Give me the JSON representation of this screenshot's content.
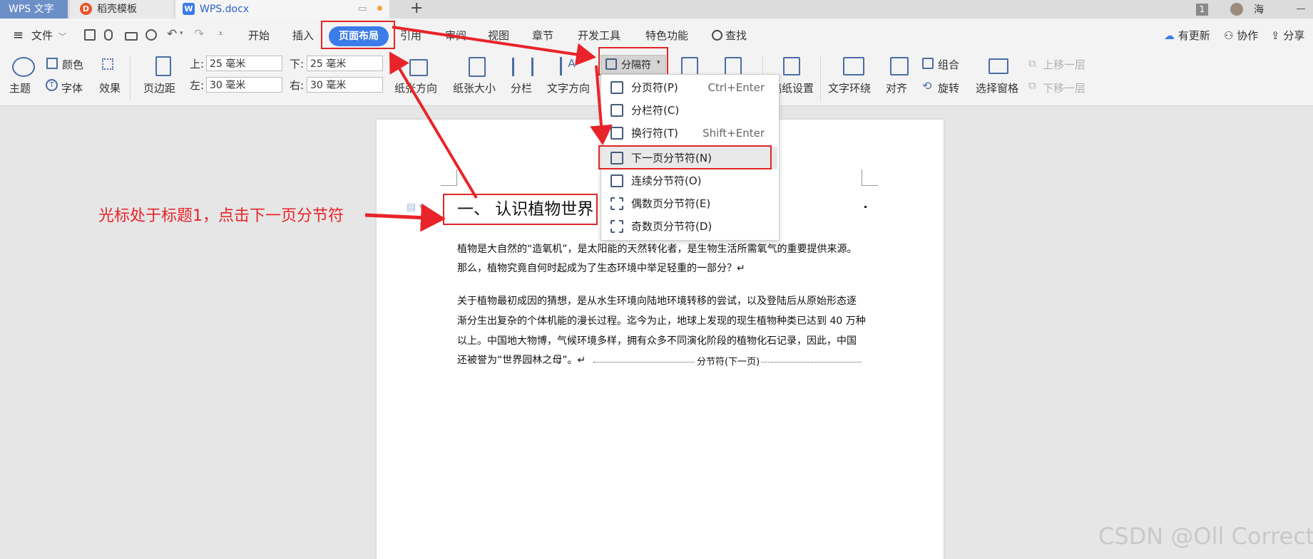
{
  "tabs": {
    "wps": "WPS 文字",
    "daoke": "稻壳模板",
    "doc": "WPS.docx",
    "add": "+",
    "badge": "1",
    "user": "海"
  },
  "menu": {
    "hamburger": "≡",
    "file": "文件",
    "items": [
      "开始",
      "插入",
      "页面布局",
      "引用",
      "审阅",
      "视图",
      "章节",
      "开发工具",
      "特色功能",
      "查找"
    ],
    "update": "有更新",
    "collab": "协作",
    "share": "分享"
  },
  "ribbon": {
    "theme": "主题",
    "color": "颜色",
    "font": "字体",
    "effect": "效果",
    "margin": "页边距",
    "top_label": "上:",
    "top_value": "25 毫米",
    "bottom_label": "下:",
    "bottom_value": "25 毫米",
    "left_label": "左:",
    "left_value": "30 毫米",
    "right_label": "右:",
    "right_value": "30 毫米",
    "orientation": "纸张方向",
    "size": "纸张大小",
    "columns": "分栏",
    "text_dir": "文字方向",
    "breaks": "分隔符",
    "paper_settings": "稿纸设置",
    "wrap": "文字环绕",
    "align": "对齐",
    "group": "组合",
    "rotate": "旋转",
    "select_pane": "选择窗格",
    "bring_forward": "上移一层",
    "send_backward": "下移一层"
  },
  "dropdown": [
    {
      "label": "分页符(P)",
      "shortcut": "Ctrl+Enter"
    },
    {
      "label": "分栏符(C)",
      "shortcut": ""
    },
    {
      "label": "换行符(T)",
      "shortcut": "Shift+Enter"
    },
    {
      "label": "下一页分节符(N)",
      "shortcut": ""
    },
    {
      "label": "连续分节符(O)",
      "shortcut": ""
    },
    {
      "label": "偶数页分节符(E)",
      "shortcut": ""
    },
    {
      "label": "奇数页分节符(D)",
      "shortcut": ""
    }
  ],
  "document": {
    "heading": "一、 认识植物世界",
    "p1": [
      "植物是大自然的“造氧机”，是太阳能的天然转化者，是生物生活所需氧气的重要提供来源。",
      "那么，植物究竟自何时起成为了生态环境中举足轻重的一部分？↵"
    ],
    "p2": [
      "关于植物最初成因的猜想，是从水生环境向陆地环境转移的尝试，以及登陆后从原始形态逐",
      "渐分生出复杂的个体机能的漫长过程。迄今为止，地球上发现的现生植物种类已达到 40 万种",
      "以上。中国地大物博，气候环境多样，拥有众多不同演化阶段的植物化石记录，因此，中国",
      "还被誉为“世界园林之母”。↵"
    ],
    "section_break": "分节符(下一页)"
  },
  "annotation": "光标处于标题1，点击下一页分节符",
  "watermark": "CSDN @Oll Correct",
  "colors": {
    "accent": "#3b7ce9",
    "annotation_red": "#e8242a",
    "tab_wps": "#6d8fc8"
  }
}
